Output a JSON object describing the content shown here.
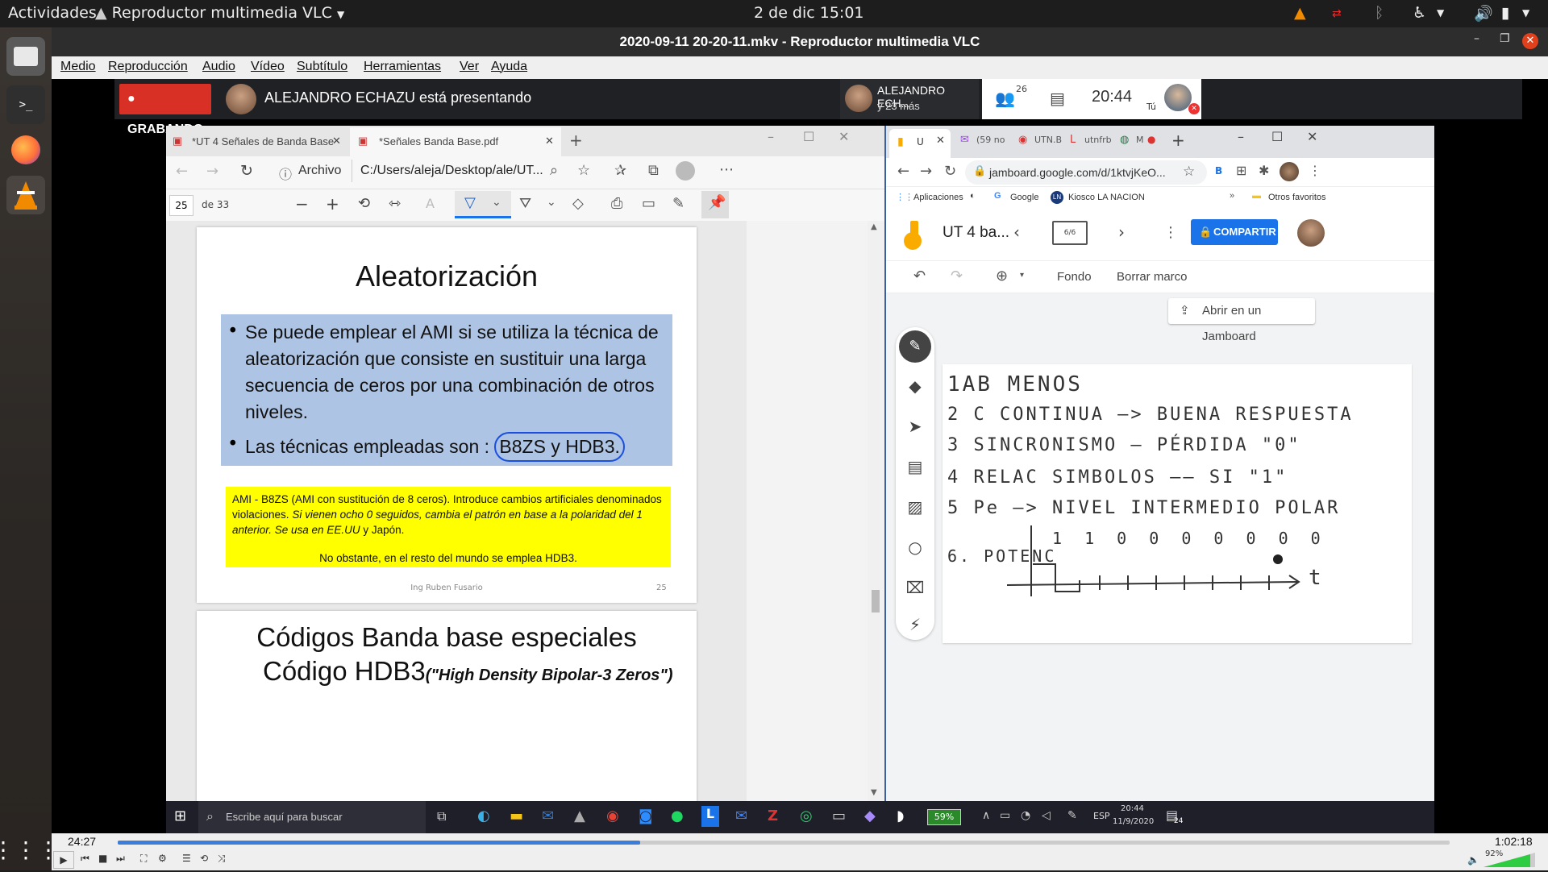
{
  "topbar": {
    "activities": "Actividades",
    "app_menu": "Reproductor multimedia VLC",
    "clock": "2 de dic  15:01"
  },
  "vlc": {
    "title": "2020-09-11 20-20-11.mkv - Reproductor multimedia VLC",
    "menu": [
      "Medio",
      "Reproducción",
      "Audio",
      "Vídeo",
      "Subtítulo",
      "Herramientas",
      "Ver",
      "Ayuda"
    ],
    "time_elapsed": "24:27",
    "time_total": "1:02:18",
    "progress": 0.392,
    "volume": "92%"
  },
  "meet": {
    "recording": "GRABANDO",
    "presenting": "ALEJANDRO ECHAZU está presentando",
    "presenter_name": "ALEJANDRO ECH...",
    "presenter_sub": "y 23 más",
    "participants": "26",
    "time": "20:44",
    "you": "Tú"
  },
  "edge": {
    "tab1": "*UT 4 Señales de Banda Base e I",
    "tab2": "*Señales Banda Base.pdf",
    "archivo": "Archivo",
    "url": "C:/Users/aleja/Desktop/ale/UT...",
    "page_num": "25",
    "page_of": "de 33"
  },
  "slide": {
    "title": "Aleatorización",
    "bullet1": "Se puede emplear el AMI si se utiliza la técnica de aleatorización que consiste en sustituir una larga secuencia de ceros por una combinación de otros niveles.",
    "bullet2_prefix": "Las técnicas empleadas son : ",
    "bullet2_circled": "B8ZS y HDB3.",
    "note_line1": "AMI - B8ZS (AMI con sustitución de 8 ceros). Introduce cambios artificiales denominados violaciones.",
    "note_italic": "Si vienen ocho 0 seguidos, cambia el patrón en base a la polaridad del 1 anterior. Se usa en EE.UU",
    "note_tail": " y Japón.",
    "note_line2": "No obstante, en el resto del mundo se emplea HDB3.",
    "footer": "Ing Ruben Fusario",
    "page": "25",
    "next_title1": "Códigos Banda base especiales",
    "next_title2": "Código HDB3",
    "next_title2_sub": "(\"High Density Bipolar-3 Zeros\")"
  },
  "chrome": {
    "url": "jamboard.google.com/d/1ktvjKeO...",
    "bookmarks": [
      "Aplicaciones",
      "Google",
      "Kiosco LA NACION",
      "Otros favoritos"
    ],
    "tabs": [
      "U",
      "(59 no",
      "UTN.B",
      "utnfrb",
      "M"
    ],
    "doc_title": "UT 4 ba...",
    "frame": "6/6",
    "share": "COMPARTIR",
    "fondo": "Fondo",
    "borrar": "Borrar marco",
    "open_in": "Abrir en un Jamboard"
  },
  "jam": {
    "lines": [
      "1AB MENOS",
      "2 C CONTINUA —> BUENA RESPUESTA",
      "3 SINCRONISMO — PÉRDIDA \"0\"",
      "4 RELAC SIMBOLOS —— SI \"1\"",
      "5 Pe —> NIVEL INTERMEDIO POLAR",
      "6. POTENC",
      "1 1 0 0 0 0 0 0 0",
      "t"
    ]
  },
  "taskbar": {
    "search": "Escribe aquí para buscar",
    "battery": "59%",
    "lang": "ESP",
    "time": "20:44",
    "date": "11/9/2020",
    "notif": "24"
  }
}
